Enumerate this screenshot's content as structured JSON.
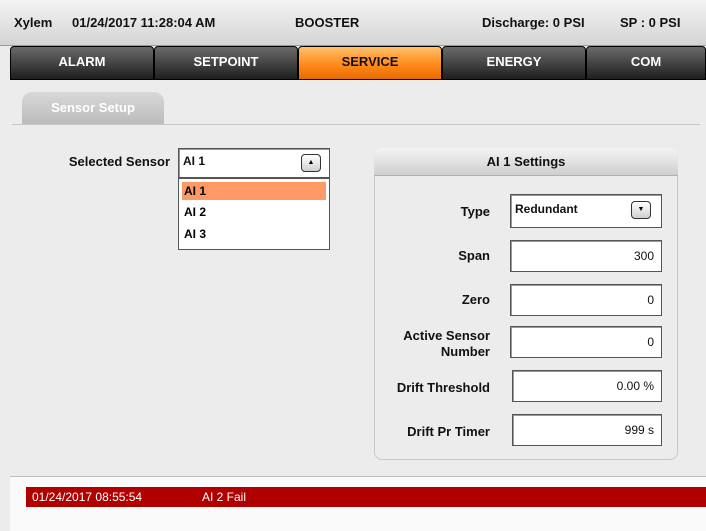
{
  "status_bar": {
    "brand": "Xylem",
    "datetime": "01/24/2017 11:28:04 AM",
    "mode": "BOOSTER",
    "discharge": "Discharge: 0 PSI",
    "setpoint": "SP : 0 PSI"
  },
  "tabs": [
    {
      "label": "ALARM",
      "active": false
    },
    {
      "label": "SETPOINT",
      "active": false
    },
    {
      "label": "SERVICE",
      "active": true
    },
    {
      "label": "ENERGY",
      "active": false
    },
    {
      "label": "COM",
      "active": false
    }
  ],
  "subtab": {
    "label": "Sensor Setup"
  },
  "sensor_select": {
    "label": "Selected Sensor",
    "value": "AI 1",
    "options": [
      "AI 1",
      "AI 2",
      "AI 3"
    ],
    "selected_index": 0
  },
  "settings": {
    "title": "AI 1  Settings",
    "type_label": "Type",
    "type_value": "Redundant",
    "span_label": "Span",
    "span_value": "300",
    "zero_label": "Zero",
    "zero_value": "0",
    "active_sensor_label_1": "Active Sensor",
    "active_sensor_label_2": "Number",
    "active_sensor_value": "0",
    "drift_threshold_label": "Drift Threshold",
    "drift_threshold_value": "0.00 %",
    "drift_timer_label": "Drift Pr Timer",
    "drift_timer_value": "999 s"
  },
  "alarm_log": [
    {
      "timestamp": "01/24/2017 08:55:54",
      "message": "AI 2 Fail",
      "color": "#b00000"
    }
  ],
  "colors": {
    "active_tab": "#ff8a1a",
    "selected_option": "#ff9a66",
    "alarm": "#b00000"
  }
}
